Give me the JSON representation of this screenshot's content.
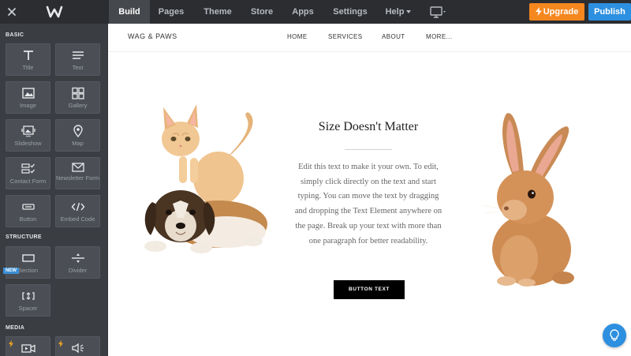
{
  "topbar": {
    "tabs": [
      "Build",
      "Pages",
      "Theme",
      "Store",
      "Apps",
      "Settings",
      "Help"
    ],
    "upgrade_label": "Upgrade",
    "publish_label": "Publish"
  },
  "sidebar": {
    "sections": {
      "basic": "BASIC",
      "structure": "STRUCTURE",
      "media": "MEDIA"
    },
    "basic_items": [
      {
        "label": "Title",
        "icon": "title-icon"
      },
      {
        "label": "Text",
        "icon": "text-icon"
      },
      {
        "label": "Image",
        "icon": "image-icon"
      },
      {
        "label": "Gallery",
        "icon": "gallery-icon"
      },
      {
        "label": "Slideshow",
        "icon": "slideshow-icon"
      },
      {
        "label": "Map",
        "icon": "map-pin-icon"
      },
      {
        "label": "Contact Form",
        "icon": "contact-form-icon"
      },
      {
        "label": "Newsletter Form",
        "icon": "envelope-icon"
      },
      {
        "label": "Button",
        "icon": "button-icon"
      },
      {
        "label": "Embed Code",
        "icon": "code-icon"
      }
    ],
    "structure_items": [
      {
        "label": "Section",
        "icon": "section-icon"
      },
      {
        "label": "Divider",
        "icon": "divider-icon"
      },
      {
        "label": "Spacer",
        "icon": "spacer-icon"
      }
    ],
    "new_badge": "NEW"
  },
  "site": {
    "name": "WAG & PAWS",
    "nav": [
      "HOME",
      "SERVICES",
      "ABOUT",
      "MORE..."
    ],
    "hero_title": "Size Doesn't Matter",
    "hero_body": "Edit this text to make it your own. To edit, simply click directly on the text and start typing. You can move the text by dragging and dropping the Text Element anywhere on the page. Break up your text with more than one paragraph for better readability.",
    "hero_button": "BUTTON TEXT"
  },
  "colors": {
    "topbar": "#2b2d31",
    "sidebar": "#3a3d42",
    "upgrade": "#f5871f",
    "publish": "#2d8fe0"
  }
}
